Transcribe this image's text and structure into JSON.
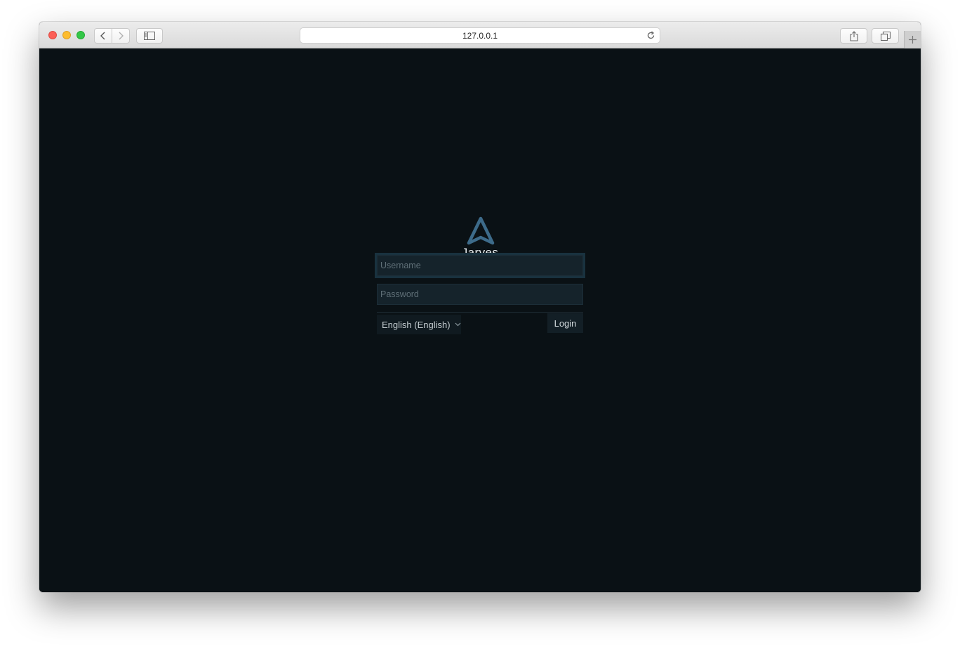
{
  "browser": {
    "url": "127.0.0.1",
    "icons": {
      "close": "close-button-icon",
      "minimize": "minimize-button-icon",
      "maximize": "maximize-button-icon",
      "back": "chevron-left-icon",
      "forward": "chevron-right-icon",
      "sidebar": "sidebar-icon",
      "reload": "reload-icon",
      "share": "share-icon",
      "tabs": "tabs-overview-icon",
      "new_tab": "plus-icon"
    }
  },
  "app": {
    "brand": "Jarves",
    "logo_icon": "triangle-logo-icon",
    "colors": {
      "background": "#0a1115",
      "field_background": "#15232b",
      "logo": "#3d6b8a",
      "text": "#e6ecef"
    }
  },
  "login_form": {
    "username_placeholder": "Username",
    "password_placeholder": "Password",
    "username_value": "",
    "password_value": "",
    "language_selected": "English (English)",
    "login_label": "Login"
  }
}
